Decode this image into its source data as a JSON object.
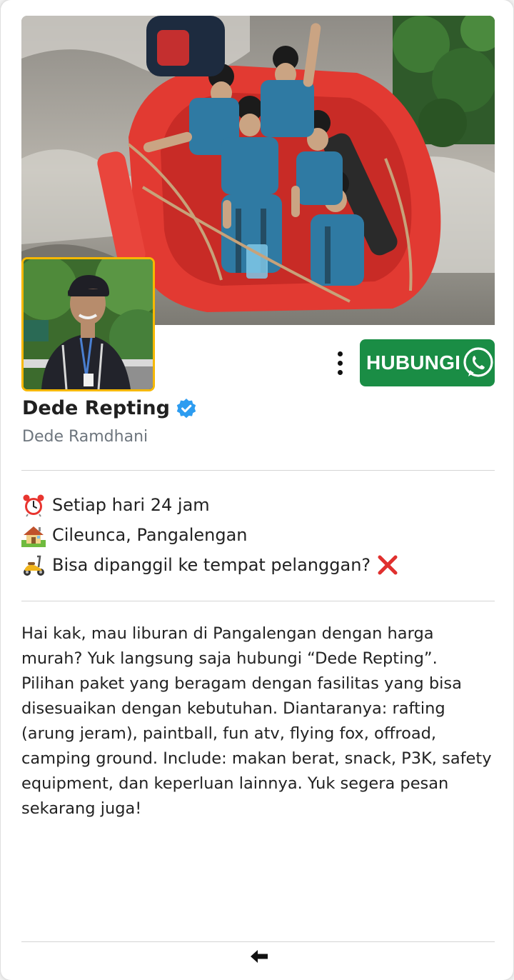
{
  "profile": {
    "display_name": "Dede Repting",
    "verified": true,
    "sub_name": "Dede Ramdhani",
    "cover_image": "rafting-group-photo",
    "avatar_image": "profile-portrait"
  },
  "actions": {
    "contact_label": "HUBUNGI",
    "contact_icon": "whatsapp-icon",
    "more_icon": "more-vertical-icon"
  },
  "info": [
    {
      "icon": "alarm-clock-icon",
      "text": "Setiap hari 24 jam"
    },
    {
      "icon": "house-icon",
      "text": "Cileunca, Pangalengan"
    },
    {
      "icon": "scooter-icon",
      "text": "Bisa dipanggil ke tempat pelanggan?",
      "status_icon": "cross-mark-icon"
    }
  ],
  "description": "Hai kak, mau liburan di Pangalengan dengan harga murah? Yuk langsung saja hubungi “Dede Repting”. Pilihan paket yang beragam dengan fasilitas yang bisa disesuaikan dengan kebutuhan. Diantaranya: rafting (arung jeram), paintball, fun atv, flying fox, offroad, camping ground. Include: makan berat, snack, P3K, safety equipment, dan keperluan lainnya. Yuk segera pesan sekarang juga!",
  "footer": {
    "back_icon": "back-arrow-icon"
  },
  "colors": {
    "contact_button": "#1a8d45",
    "avatar_border": "#f6b800",
    "verified_badge": "#2d9cf0",
    "sub_name": "#6d757d",
    "cross_mark": "#e0302e"
  }
}
